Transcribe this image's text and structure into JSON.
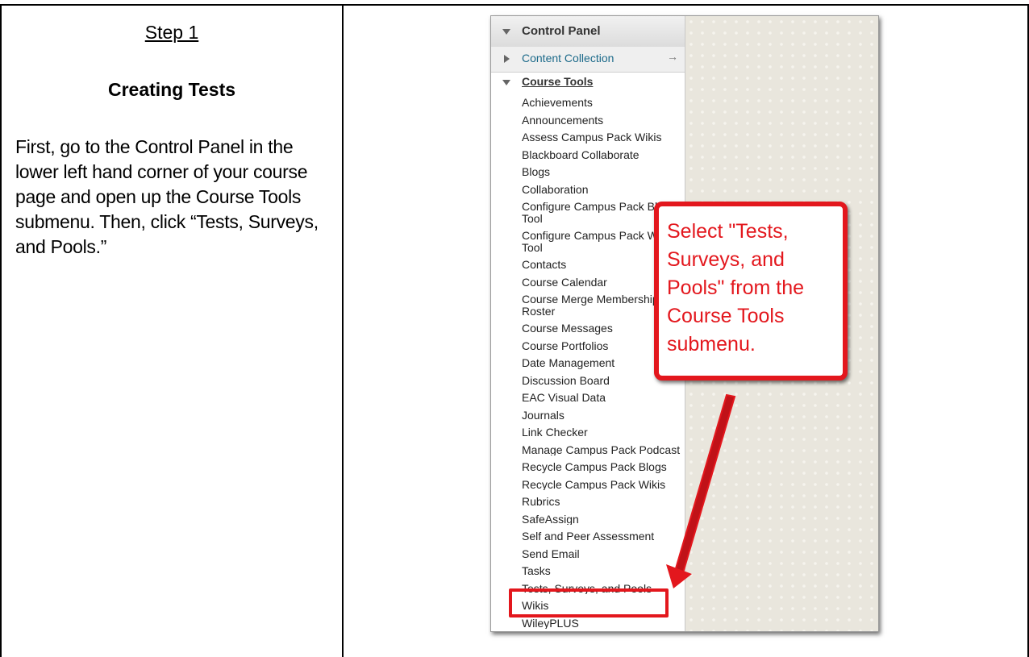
{
  "document": {
    "step_title": "Step 1",
    "section_heading": "Creating Tests",
    "instructions": "First, go to the Control Panel in the lower left hand corner of your course page and open up the Course Tools submenu. Then, click “Tests, Surveys, and Pools.”"
  },
  "screenshot": {
    "control_panel_label": "Control Panel",
    "content_collection_label": "Content Collection",
    "content_collection_arrow": "→",
    "course_tools_label": "Course Tools",
    "course_tools": [
      "Achievements",
      "Announcements",
      "Assess Campus Pack Wikis",
      "Blackboard Collaborate",
      "Blogs",
      "Collaboration",
      "Configure Campus Pack Blogs Tool",
      "Configure Campus Pack Wikis Tool",
      "Contacts",
      "Course Calendar",
      "Course Merge Membership Roster",
      "Course Messages",
      "Course Portfolios",
      "Date Management",
      "Discussion Board",
      "EAC Visual Data",
      "Journals",
      "Link Checker",
      "Manage Campus Pack Podcast",
      "Recycle Campus Pack Blogs",
      "Recycle Campus Pack Wikis",
      "Rubrics",
      "SafeAssign",
      "Self and Peer Assessment",
      "Send Email",
      "Tasks",
      "Tests, Surveys, and Pools",
      "Wikis",
      "WileyPLUS"
    ],
    "highlight_color": "#e3171d"
  },
  "callout": {
    "text": "Select \"Tests, Surveys, and Pools\" from the Course Tools submenu."
  }
}
